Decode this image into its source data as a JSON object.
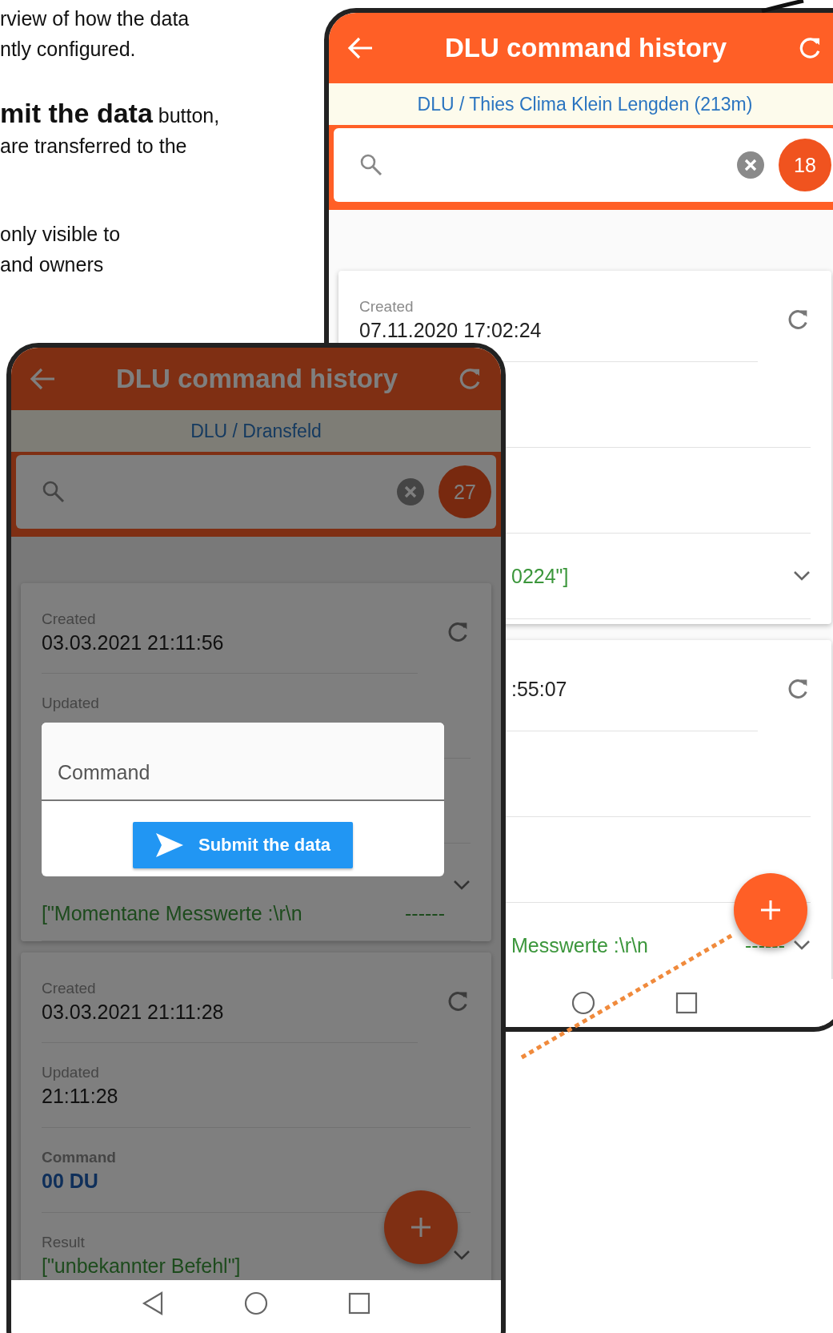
{
  "document_text": [
    {
      "paragraph": [
        "rview of how the data",
        "ntly configured."
      ]
    },
    {
      "paragraph": [
        "**mit the data** button,",
        "are transferred to the"
      ]
    },
    {
      "paragraph": [
        "only visible to",
        "and owners"
      ]
    }
  ],
  "back_phone": {
    "title": "DLU command history",
    "location": "DLU / Thies Clima Klein Lengden (213m)",
    "search": {
      "count": "18"
    },
    "cards": [
      {
        "rows": [
          {
            "kind": "created",
            "label": "Created",
            "value": "07.11.2020 17:02:24",
            "partial": false
          },
          {
            "kind": "updated"
          },
          {
            "kind": "command"
          },
          {
            "kind": "result",
            "value": "0224\"]",
            "partial": true
          }
        ]
      },
      {
        "rows": [
          {
            "kind": "created",
            "value": ":55:07",
            "partial": true
          },
          {
            "kind": "updated"
          },
          {
            "kind": "command"
          },
          {
            "kind": "result",
            "value": "Messwerte :\\r\\n",
            "tail": "------",
            "partial": true
          }
        ]
      }
    ]
  },
  "front_phone": {
    "title": "DLU command history",
    "location": "DLU / Dransfeld",
    "search": {
      "count": "27"
    },
    "cards": [
      {
        "rows": [
          {
            "kind": "created",
            "label": "Created",
            "value": "03.03.2021 21:11:56",
            "partial": false
          },
          {
            "kind": "updated",
            "label": "Updated"
          },
          {
            "kind": "command"
          },
          {
            "kind": "result",
            "value": "[\"Momentane Messwerte :\\r\\n",
            "tail": "------",
            "partial": false
          }
        ]
      },
      {
        "rows": [
          {
            "kind": "created",
            "label": "Created",
            "value": "03.03.2021 21:11:28",
            "partial": false
          },
          {
            "kind": "updated",
            "label": "Updated",
            "value": "21:11:28",
            "partial": false
          },
          {
            "kind": "command",
            "label": "Command",
            "value": "00 DU",
            "partial": false
          },
          {
            "kind": "result",
            "label": "Result",
            "value": "[\"unbekannter Befehl\"]",
            "partial": false
          }
        ]
      }
    ],
    "dialog": {
      "field": {
        "placeholder": "Command"
      },
      "button": "Submit the data"
    }
  }
}
